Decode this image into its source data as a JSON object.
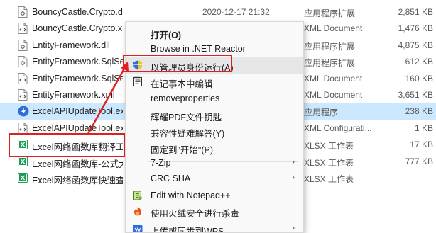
{
  "files": [
    {
      "name": "BouncyCastle.Crypto.dll",
      "date": "2020-12-17 21:32",
      "type": "应用程序扩展",
      "size": "2,851 KB",
      "icon": "dll-icon"
    },
    {
      "name": "BouncyCastle.Crypto.xml",
      "date": "",
      "type": "XML Document",
      "size": "1,476 KB",
      "icon": "xml-icon"
    },
    {
      "name": "EntityFramework.dll",
      "date": "",
      "type": "应用程序扩展",
      "size": "4,875 KB",
      "icon": "dll-icon"
    },
    {
      "name": "EntityFramework.SqlServer.dll",
      "date": "",
      "type": "应用程序扩展",
      "size": "612 KB",
      "icon": "dll-icon"
    },
    {
      "name": "EntityFramework.SqlServer.xml",
      "date": "",
      "type": "XML Document",
      "size": "160 KB",
      "icon": "xml-icon"
    },
    {
      "name": "EntityFramework.xml",
      "date": "",
      "type": "XML Document",
      "size": "3,651 KB",
      "icon": "xml-icon"
    },
    {
      "name": "ExcelAPIUpdateTool.exe",
      "date": "",
      "type": "应用程序",
      "size": "238 KB",
      "icon": "exe-icon",
      "selected": true
    },
    {
      "name": "ExcelAPIUpdateTool.exe.config",
      "date": "",
      "type": "XML Configurati...",
      "size": "1 KB",
      "icon": "xml-icon"
    },
    {
      "name": "Excel网络函数库翻译工具.xlsx",
      "date": "",
      "type": "XLSX 工作表",
      "size": "17 KB",
      "icon": "xlsx-icon"
    },
    {
      "name": "Excel网络函数库-公式大全.xlsx",
      "date": "",
      "type": "XLSX 工作表",
      "size": "777 KB",
      "icon": "xlsx-icon"
    },
    {
      "name": "Excel网络函数库快速查询.xlsx",
      "date": "",
      "type": "XLSX 工作表",
      "size": "",
      "icon": "xlsx-icon"
    }
  ],
  "menu": {
    "items": [
      {
        "label": "打开(O)",
        "bold": true
      },
      {
        "label": "Browse in .NET Reactor"
      },
      {
        "label": "以管理员身份运行(A)",
        "icon": "shield-icon",
        "highlight": true
      },
      {
        "label": "在记事本中编辑",
        "icon": "notepad-icon"
      },
      {
        "label": "removeproperties"
      },
      {
        "label": "辉耀PDF文件钥匙"
      },
      {
        "label": "兼容性疑难解答(Y)"
      },
      {
        "label": "固定到\"开始\"(P)"
      },
      {
        "label": "7-Zip",
        "submenu": true
      },
      {
        "label": "CRC SHA",
        "submenu": true
      },
      {
        "label": "Edit with Notepad++",
        "icon": "notepadpp-icon"
      },
      {
        "label": "使用火绒安全进行杀毒",
        "icon": "huorong-icon"
      },
      {
        "label": "上传或同步到WPS",
        "icon": "wps-icon",
        "submenu": true
      }
    ]
  },
  "colors": {
    "selected_row": "#cce8ff",
    "annotation": "#e02020",
    "menu_bg": "#f9f9f9",
    "menu_highlight": "#e6e6e6"
  }
}
